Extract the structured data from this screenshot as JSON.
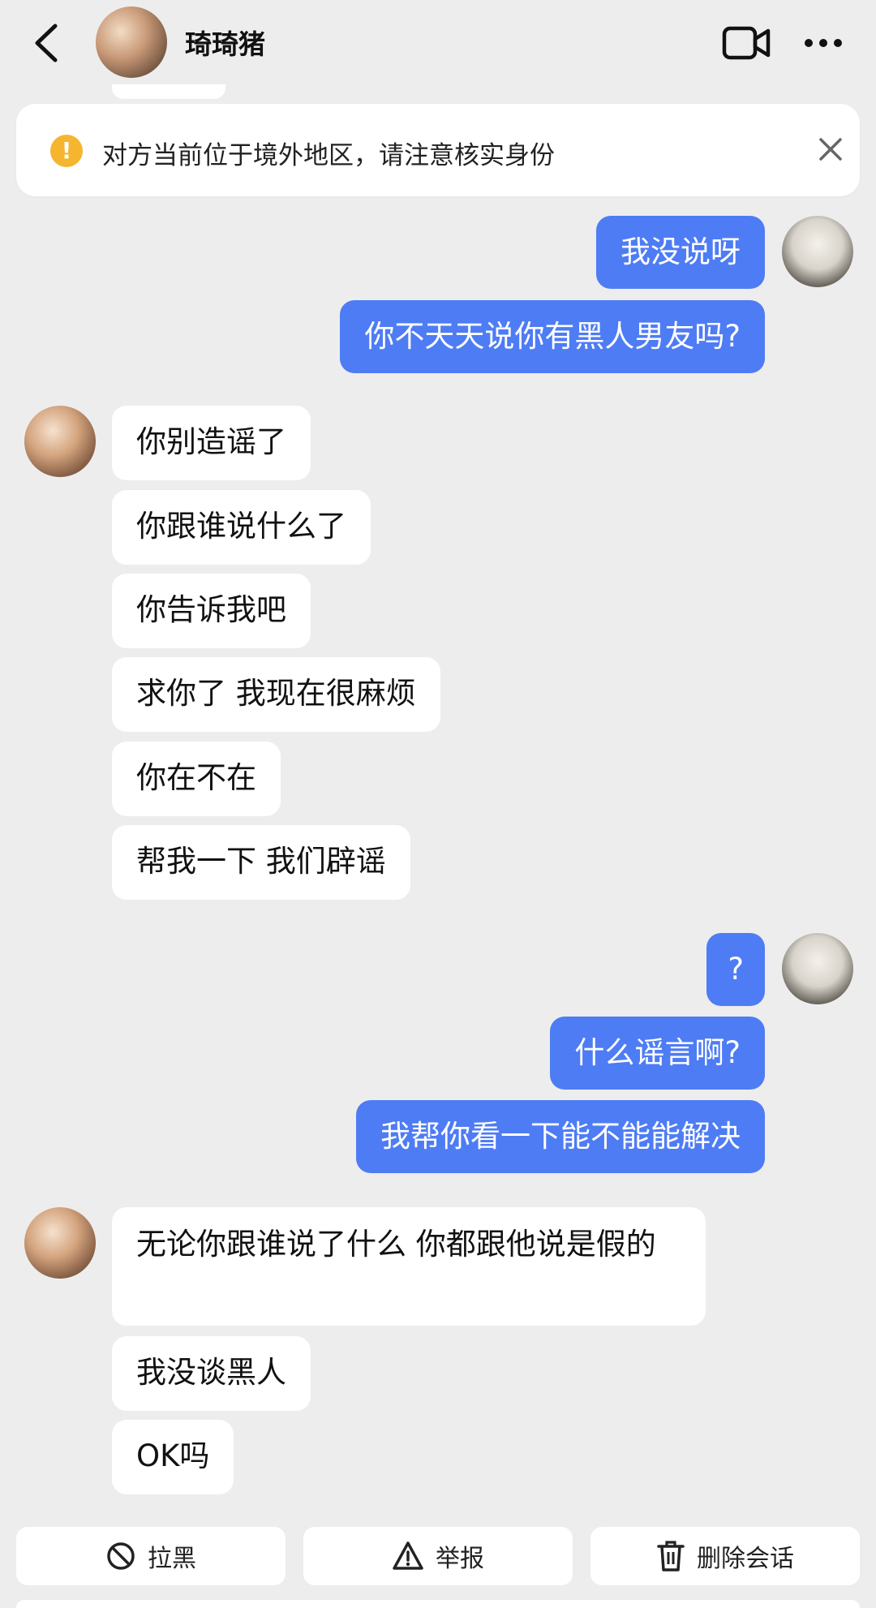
{
  "header": {
    "contact_name": "琦琦猪",
    "icons": {
      "back": "chevron-left-icon",
      "video": "video-camera-icon",
      "more": "more-dots-icon"
    }
  },
  "notice": {
    "text": "对方当前位于境外地区，请注意核实身份",
    "icon": "warning-icon",
    "close_icon": "close-icon"
  },
  "messages": [
    {
      "side": "out",
      "text": "我没说呀"
    },
    {
      "side": "out",
      "text": "你不天天说你有黑人男友吗?"
    },
    {
      "side": "in",
      "text": "你别造谣了"
    },
    {
      "side": "in",
      "text": "你跟谁说什么了"
    },
    {
      "side": "in",
      "text": "你告诉我吧"
    },
    {
      "side": "in",
      "text": "求你了 我现在很麻烦"
    },
    {
      "side": "in",
      "text": "你在不在"
    },
    {
      "side": "in",
      "text": "帮我一下 我们辟谣"
    },
    {
      "side": "out",
      "text": "?"
    },
    {
      "side": "out",
      "text": "什么谣言啊?"
    },
    {
      "side": "out",
      "text": "我帮你看一下能不能能解决"
    },
    {
      "side": "in",
      "text": "无论你跟谁说了什么 你都跟他说是假的"
    },
    {
      "side": "in",
      "text": "我没谈黑人"
    },
    {
      "side": "in",
      "text": "OK吗"
    }
  ],
  "actions": [
    {
      "label": "拉黑",
      "icon": "block-icon"
    },
    {
      "label": "举报",
      "icon": "warning-triangle-icon"
    },
    {
      "label": "删除会话",
      "icon": "trash-icon"
    }
  ],
  "colors": {
    "background": "#ededed",
    "outgoing_bubble": "#4e7cf5",
    "incoming_bubble": "#ffffff",
    "warning": "#f5b52e"
  }
}
